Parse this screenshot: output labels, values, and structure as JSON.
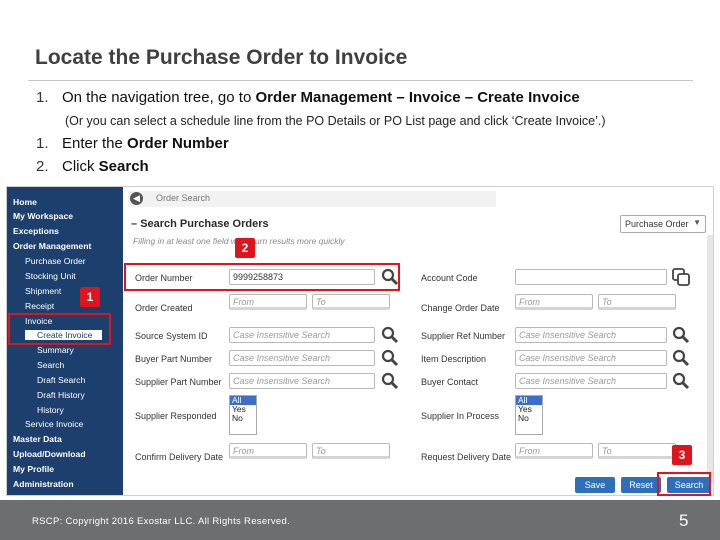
{
  "slide": {
    "title": "Locate the Purchase Order to Invoice",
    "steps": [
      {
        "num": "1.",
        "pre": "On the navigation tree, go to ",
        "bold": "Order Management – Invoice – Create Invoice"
      },
      {
        "num": "1.",
        "pre": "Enter the ",
        "bold": "Order Number"
      },
      {
        "num": "2.",
        "pre": "Click ",
        "bold": "Search"
      }
    ],
    "note": "(Or you can select a schedule line from the PO Details or PO List page and click ‘Create Invoice’.)",
    "footer": "RSCP:  Copyright 2016 Exostar LLC. All Rights Reserved.",
    "page_number": "5",
    "callouts": [
      "1",
      "2",
      "3"
    ],
    "accent_color": "#e0151b"
  },
  "nav": {
    "items": [
      "Home",
      "My Workspace",
      "Exceptions",
      "Order Management",
      "Purchase Order",
      "Stocking Unit",
      "Shipment",
      "Receipt",
      "Invoice",
      "Create Invoice",
      "Summary",
      "Search",
      "Draft Search",
      "Draft History",
      "History",
      "Service Invoice",
      "Master Data",
      "Upload/Download",
      "My Profile",
      "Administration"
    ]
  },
  "main": {
    "breadcrumb": "Order Search",
    "section_title": "Search Purchase Orders",
    "hint": "Filling in at least one field will return results more quickly",
    "type_select": "Purchase Order",
    "placeholder": "Case Insensitive Search",
    "from": "From",
    "to": "To",
    "order_number_value": "9999258873",
    "left_labels": [
      "Order Number",
      "Order Created",
      "Source System ID",
      "Buyer Part Number",
      "Supplier Part Number",
      "Supplier Responded",
      "Confirm Delivery Date"
    ],
    "right_labels": [
      "Account Code",
      "Change Order Date",
      "Supplier Ref Number",
      "Item Description",
      "Buyer Contact",
      "Supplier In Process",
      "Request Delivery Date"
    ],
    "list_options": [
      "All",
      "Yes",
      "No"
    ],
    "buttons": {
      "save": "Save",
      "reset": "Reset",
      "search": "Search"
    }
  }
}
